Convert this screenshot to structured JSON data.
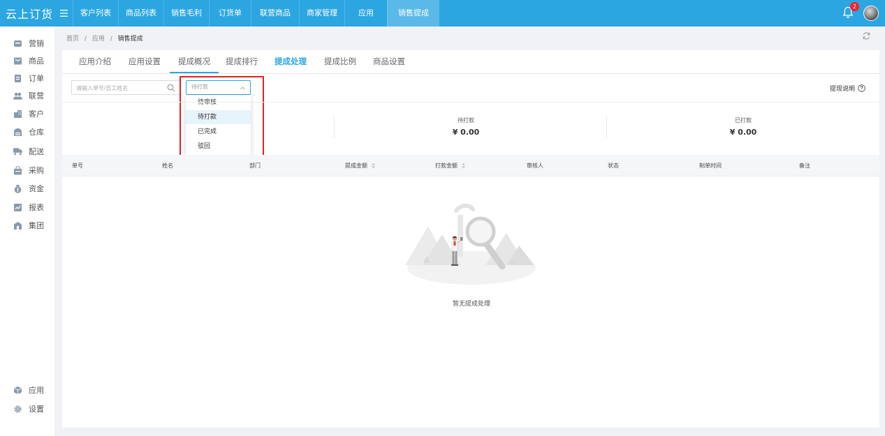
{
  "app": {
    "logo": "云上订货",
    "menu_toggle": "☰"
  },
  "topnav": [
    {
      "label": "客户列表"
    },
    {
      "label": "商品列表"
    },
    {
      "label": "销售毛利"
    },
    {
      "label": "订货单"
    },
    {
      "label": "联营商品"
    },
    {
      "label": "商家管理"
    },
    {
      "label": "应用"
    },
    {
      "label": "销售提成",
      "active": true
    }
  ],
  "header": {
    "notification_count": "2",
    "notification_icon": "bell-icon",
    "avatar_icon": "avatar"
  },
  "sidebar": {
    "items": [
      {
        "label": "营销",
        "icon": "marketing-icon"
      },
      {
        "label": "商品",
        "icon": "goods-icon"
      },
      {
        "label": "订单",
        "icon": "order-icon"
      },
      {
        "label": "联营",
        "icon": "partner-icon"
      },
      {
        "label": "客户",
        "icon": "customer-icon"
      },
      {
        "label": "仓库",
        "icon": "warehouse-icon"
      },
      {
        "label": "配送",
        "icon": "delivery-icon"
      },
      {
        "label": "采购",
        "icon": "purchase-icon"
      },
      {
        "label": "资金",
        "icon": "funds-icon"
      },
      {
        "label": "报表",
        "icon": "report-icon"
      },
      {
        "label": "集团",
        "icon": "group-icon"
      }
    ],
    "bottom_items": [
      {
        "label": "应用",
        "icon": "apps-icon"
      },
      {
        "label": "设置",
        "icon": "settings-icon"
      }
    ]
  },
  "breadcrumb": {
    "home": "首页",
    "sep": "/",
    "app": "应用",
    "current": "销售提成"
  },
  "tabs": [
    {
      "label": "应用介绍"
    },
    {
      "label": "应用设置"
    },
    {
      "label": "提成概况"
    },
    {
      "label": "提成排行"
    },
    {
      "label": "提成处理",
      "active": true
    },
    {
      "label": "提成比例"
    },
    {
      "label": "商品设置"
    }
  ],
  "filters": {
    "search_placeholder": "请输入单号/员工姓名",
    "status_value": "待打款",
    "status_options": [
      "待审核",
      "待打款",
      "已完成",
      "驳回"
    ],
    "hovered_option": "待打款"
  },
  "help_link": "提现说明",
  "stats": [
    {
      "label": "待打款",
      "value": "¥ 0.00"
    },
    {
      "label": "已打款",
      "value": "¥ 0.00"
    }
  ],
  "table": {
    "columns": [
      "单号",
      "姓名",
      "部门",
      "提成金额",
      "打款金额",
      "审核人",
      "状态",
      "制单时间",
      "备注"
    ],
    "rows": []
  },
  "empty_state": {
    "text": "暂无提成处理"
  },
  "colors": {
    "primary": "#2ba6e1",
    "highlight": "#e02020",
    "badge": "#f5222d"
  }
}
